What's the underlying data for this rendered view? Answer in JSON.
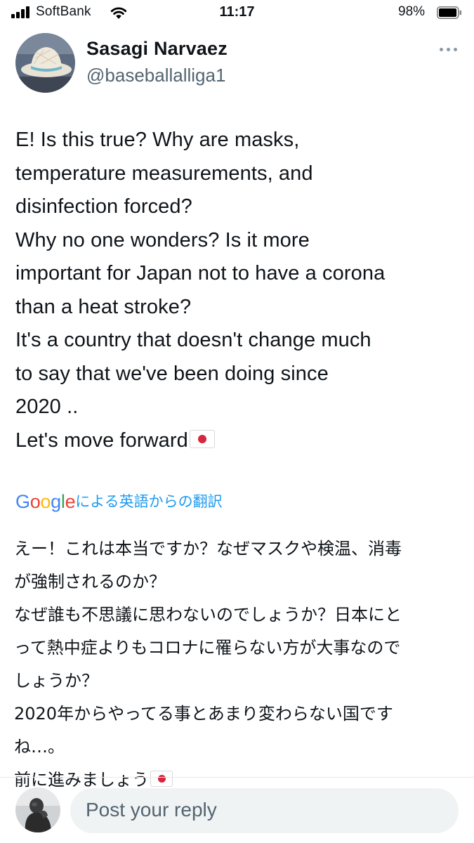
{
  "status_bar": {
    "carrier": "SoftBank",
    "time": "11:17",
    "battery_percent": "98%",
    "battery_level": 0.98,
    "signal_icon": "signal-bars-icon",
    "wifi_icon": "wifi-icon"
  },
  "tweet": {
    "author": {
      "display_name": "Sasagi Narvaez",
      "handle": "@baseballalliga1",
      "avatar_icon": "straw-hat-avatar"
    },
    "more_icon": "more-horizontal-icon",
    "text_lines": [
      "E! Is this true? Why are masks,",
      "temperature measurements, and",
      "disinfection forced?",
      "Why no one wonders? Is it more",
      "important for Japan not to have a corona",
      "than a heat stroke?",
      "It's a country that doesn't change much",
      "to say that we've been doing since",
      "2020 ..",
      "Let's move forward"
    ],
    "text_end_emoji": "japan-flag-icon"
  },
  "translation": {
    "brand": "Google",
    "brand_colors": [
      "#4285F4",
      "#EA4335",
      "#FBBC05",
      "#4285F4",
      "#34A853",
      "#EA4335"
    ],
    "label": "による英語からの翻訳",
    "link_color": "#1d9bf0",
    "text_lines": [
      "えー！これは本当ですか？なぜマスクや検温、消毒",
      "が強制されるのか？",
      "なぜ誰も不思議に思わないのでしょうか？日本にと",
      "って熱中症よりもコロナに罹らない方が大事なので",
      "しょうか？",
      "2020年からやってる事とあまり変わらない国です",
      "ね…。",
      "前に進みましょう"
    ],
    "text_end_emoji": "japan-flag-icon"
  },
  "reply": {
    "placeholder": "Post your reply",
    "avatar_icon": "statue-avatar"
  }
}
